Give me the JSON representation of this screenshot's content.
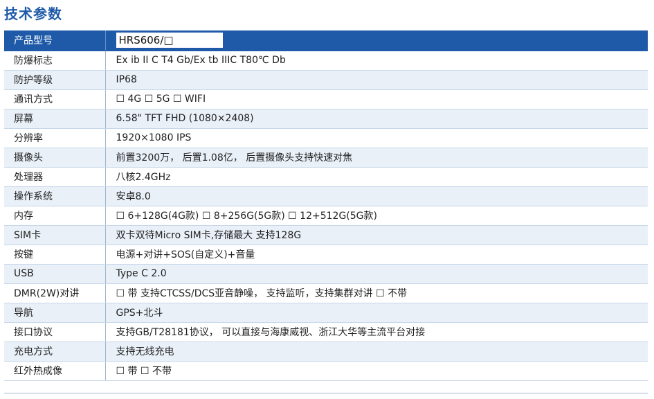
{
  "page": {
    "title": "技术参数"
  },
  "spec": {
    "header": {
      "label": "产品型号",
      "value": "HRS606/□"
    },
    "rows": [
      {
        "label": "防爆标志",
        "value": "Ex ib II C T4 Gb/Ex tb IIIC T80℃ Db"
      },
      {
        "label": "防护等级",
        "value": "IP68"
      },
      {
        "label": "通讯方式",
        "value": "☐ 4G   ☐ 5G   ☐ WIFI"
      },
      {
        "label": "屏幕",
        "value": "6.58\" TFT FHD (1080×2408)"
      },
      {
        "label": "分辨率",
        "value": "1920×1080 IPS"
      },
      {
        "label": "摄像头",
        "value": "前置3200万， 后置1.08亿， 后置摄像头支持快速对焦"
      },
      {
        "label": "处理器",
        "value": "八核2.4GHz"
      },
      {
        "label": "操作系统",
        "value": "安卓8.0"
      },
      {
        "label": "内存",
        "value": "☐ 6+128G(4G款)   ☐ 8+256G(5G款)   ☐ 12+512G(5G款)"
      },
      {
        "label": "SIM卡",
        "value": "双卡双待Micro SIM卡,存储最大 支持128G"
      },
      {
        "label": "按键",
        "value": "电源+对讲+SOS(自定义)+音量"
      },
      {
        "label": "USB",
        "value": "Type C 2.0"
      },
      {
        "label": "DMR(2W)对讲",
        "value": "☐ 带  支持CTCSS/DCS亚音静噪， 支持监听，支持集群对讲    ☐ 不带"
      },
      {
        "label": "导航",
        "value": "GPS+北斗"
      },
      {
        "label": "接口协议",
        "value": "支持GB/T28181协议， 可以直接与海康威视、浙江大华等主流平台对接"
      },
      {
        "label": "充电方式",
        "value": "支持无线充电"
      },
      {
        "label": "红外热成像",
        "value": "☐ 带   ☐ 不带"
      }
    ]
  }
}
